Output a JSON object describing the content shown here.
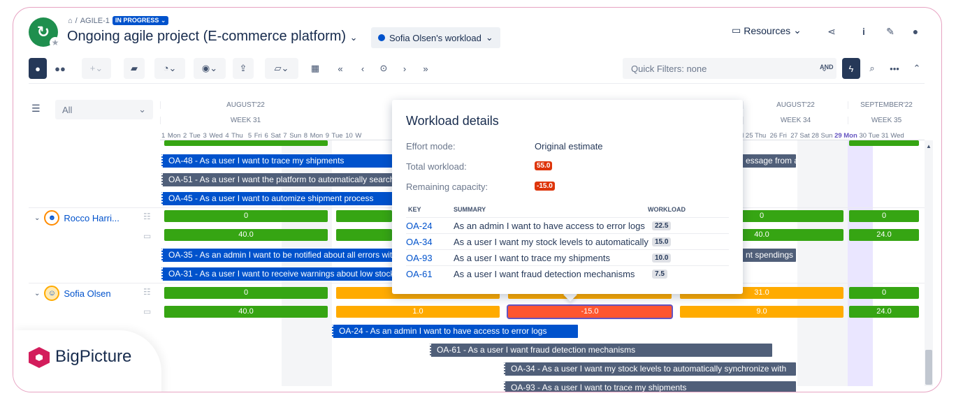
{
  "breadcrumb": {
    "project": "AGILE-1",
    "status": "IN PROGRESS"
  },
  "project_title": "Ongoing agile project (E-commerce platform)",
  "workload_view": "Sofia Olsen's workload",
  "resources_label": "Resources",
  "quick_filters": "Quick Filters: none",
  "and_label": "AND",
  "filter_value": "All",
  "timeline": {
    "months": [
      "AUGUST'22",
      "AUGUST'22",
      "SEPTEMBER'22"
    ],
    "weeks": [
      "WEEK 31",
      "WEEK 34",
      "WEEK 35"
    ],
    "days": [
      "1 Mon",
      "2 Tue",
      "3 Wed",
      "4 Thu",
      "5 Fri",
      "6 Sat",
      "7 Sun",
      "8 Mon",
      "9 Tue",
      "10 W",
      "d 25 Thu",
      "26 Fri",
      "27 Sat",
      "28 Sun",
      "29 Mon",
      "30 Tue",
      "31 Wed"
    ]
  },
  "rows": {
    "top_tasks": [
      "OA-48 - As a user I want to trace my shipments",
      "OA-51 - As a user I want the platform to automatically search",
      "OA-45 - As a user I want to automize shipment process"
    ],
    "top_task_right": "essage from a",
    "rocco": {
      "name": "Rocco Harri...",
      "capacity": [
        "0",
        "0",
        "0"
      ],
      "workload": [
        "40.0",
        "40.0",
        "24.0"
      ],
      "tasks": [
        "OA-35 - As an admin I want to be notified about all errors with",
        "OA-31 - As a user I want to receive warnings about low stock"
      ],
      "task_right": "nt spendings"
    },
    "sofia": {
      "name": "Sofia Olsen",
      "capacity": [
        "0",
        "31.0",
        "0"
      ],
      "workload": [
        "40.0",
        "1.0",
        "-15.0",
        "9.0",
        "24.0"
      ],
      "tasks": [
        "OA-24 - As an admin I want to have access to error logs",
        "OA-61 - As a user I want fraud detection mechanisms",
        "OA-34 - As a user I want my stock levels to automatically synchronize with",
        "OA-93 - As a user I want to trace my shipments"
      ]
    }
  },
  "popup": {
    "title": "Workload details",
    "effort_label": "Effort mode:",
    "effort_value": "Original estimate",
    "total_label": "Total workload:",
    "total_value": "55.0",
    "remaining_label": "Remaining capacity:",
    "remaining_value": "-15.0",
    "headers": {
      "key": "KEY",
      "summary": "SUMMARY",
      "workload": "WORKLOAD"
    },
    "items": [
      {
        "key": "OA-24",
        "summary": "As an admin I want to have access to error logs",
        "workload": "22.5"
      },
      {
        "key": "OA-34",
        "summary": "As a user I want my stock levels to automatically",
        "workload": "15.0"
      },
      {
        "key": "OA-93",
        "summary": "As a user I want to trace my shipments",
        "workload": "10.0"
      },
      {
        "key": "OA-61",
        "summary": "As a user I want fraud detection mechanisms",
        "workload": "7.5"
      }
    ]
  },
  "brand": "BigPicture",
  "colors": {
    "primary": "#0052cc",
    "green": "#36a513",
    "orange": "#ffab00",
    "red": "#ff5630",
    "brand": "#d31d5c"
  }
}
